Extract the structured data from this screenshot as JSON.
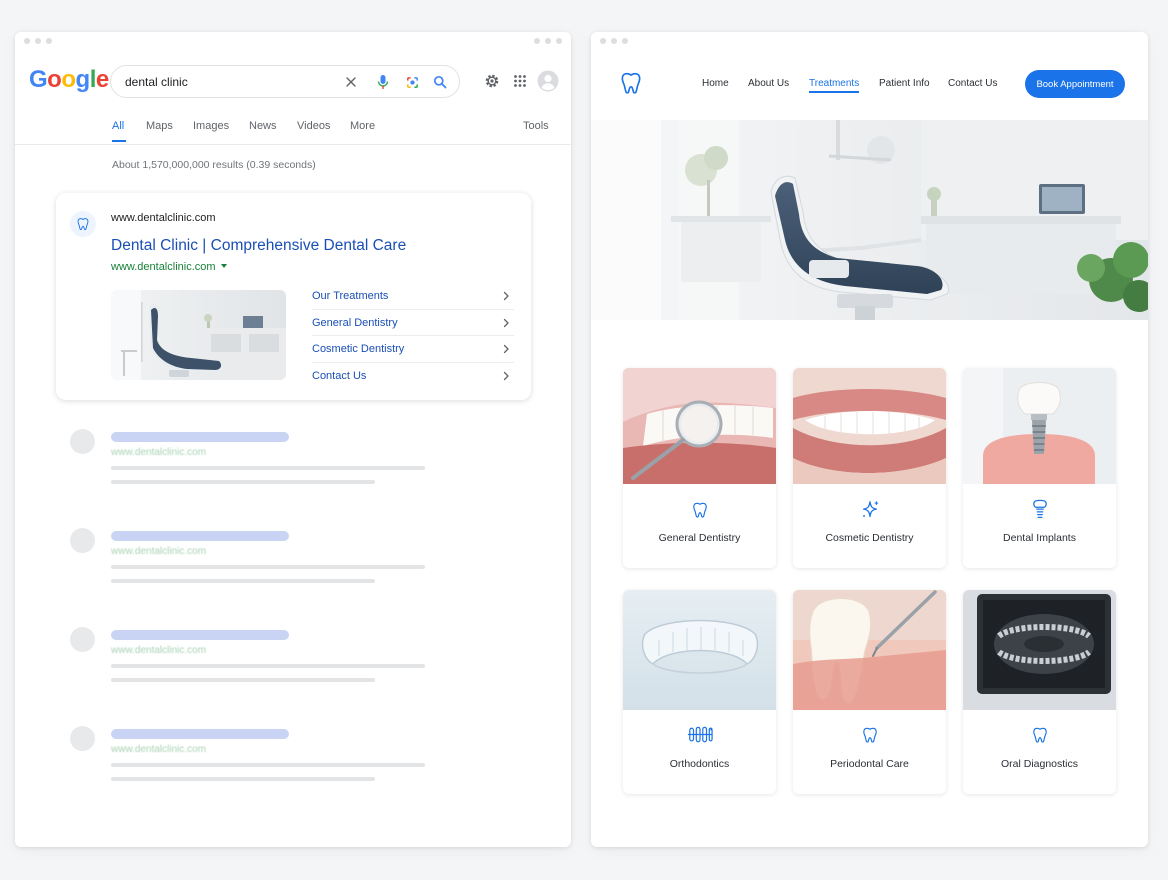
{
  "colors": {
    "google_blue": "#1a73e8",
    "link_blue": "#1a4fb5",
    "url_green": "#188038",
    "accent": "#1a73e8"
  },
  "google": {
    "logo_letters": [
      "G",
      "o",
      "o",
      "g",
      "l",
      "e"
    ],
    "logo_colors": [
      "#4285f4",
      "#ea4335",
      "#fbbc05",
      "#4285f4",
      "#34a853",
      "#ea4335"
    ],
    "search_query": "dental clinic",
    "tabs": [
      "All",
      "Maps",
      "Images",
      "News",
      "Videos",
      "More"
    ],
    "tools_label": "Tools",
    "results_stats": "About 1,570,000,000 results (0.39 seconds)",
    "result": {
      "domain": "www.dentalclinic.com",
      "title": "Dental Clinic | Comprehensive Dental Care",
      "url": "www.dentalclinic.com",
      "sitelinks": [
        "Our Treatments",
        "General Dentistry",
        "Cosmetic Dentistry",
        "Contact Us"
      ]
    },
    "placeholder_url": "www.dentalclinic.com"
  },
  "site": {
    "nav": [
      "Home",
      "About Us",
      "Treatments",
      "Patient Info",
      "Contact Us"
    ],
    "active_nav": "Treatments",
    "cta_label": "Book Appointment",
    "treatments": [
      {
        "label": "General Dentistry",
        "icon": "tooth-icon"
      },
      {
        "label": "Cosmetic Dentistry",
        "icon": "sparkle-icon"
      },
      {
        "label": "Dental Implants",
        "icon": "implant-icon"
      },
      {
        "label": "Orthodontics",
        "icon": "braces-icon"
      },
      {
        "label": "Periodontal Care",
        "icon": "tooth-icon"
      },
      {
        "label": "Oral Diagnostics",
        "icon": "tooth-icon"
      }
    ]
  }
}
